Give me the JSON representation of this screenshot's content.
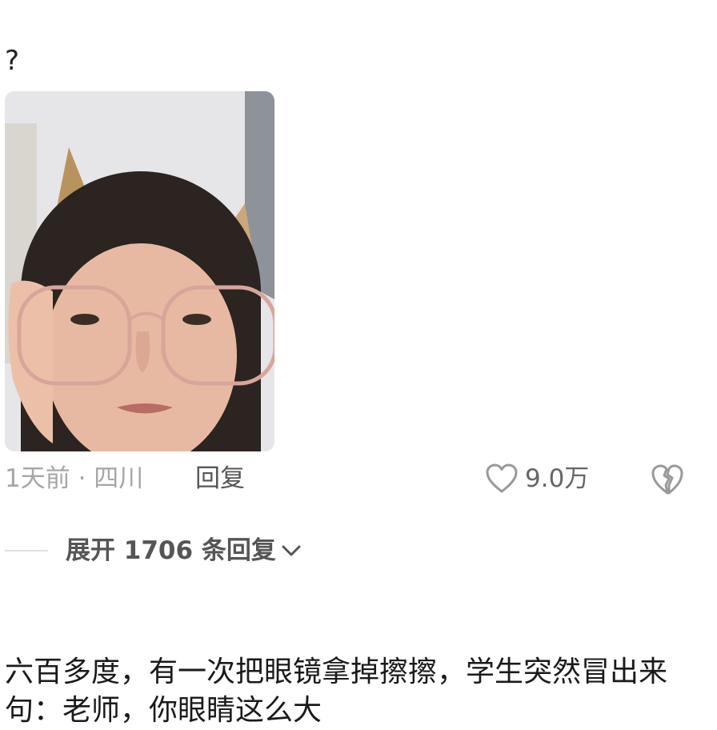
{
  "comment_prev": {
    "text": "?",
    "time_location": "1天前 · 四川",
    "reply_label": "回复",
    "like_count": "9.0万",
    "icons": {
      "like": "heart-outline-icon",
      "dislike": "broken-heart-icon"
    }
  },
  "expand_replies": {
    "label": "展开 1706 条回复",
    "icon": "chevron-down-icon"
  },
  "comment_next": {
    "text": "六百多度，有一次把眼镜拿掉擦擦，学生突然冒出来句：老师，你眼睛这么大"
  },
  "colors": {
    "meta_gray": "#a6a6a6",
    "action_gray": "#555555",
    "icon_gray": "#999999"
  }
}
